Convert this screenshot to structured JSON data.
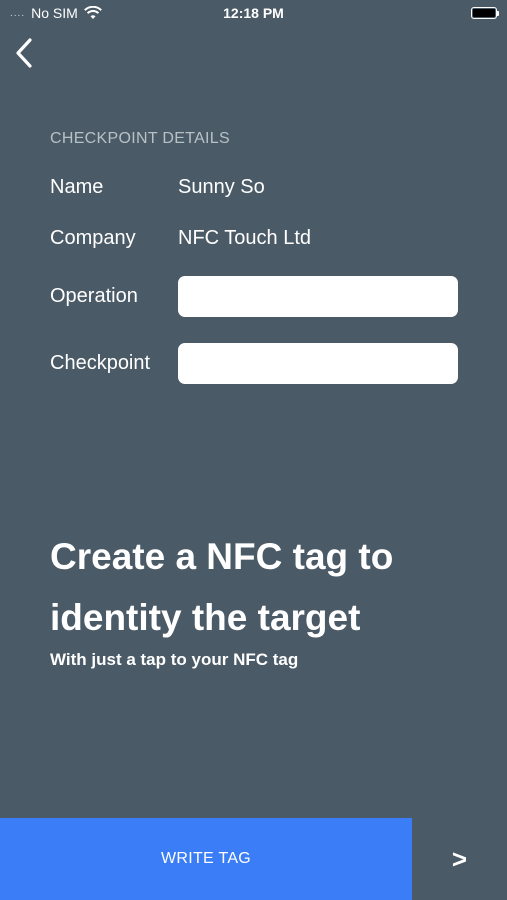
{
  "status_bar": {
    "signal": "....",
    "carrier": "No SIM",
    "time": "12:18 PM",
    "wifi_icon": "wifi-icon",
    "battery_icon": "battery-icon"
  },
  "nav": {
    "back_icon": "chevron-left-icon"
  },
  "details": {
    "section_title": "CHECKPOINT DETAILS",
    "name_label": "Name",
    "name_value": "Sunny So",
    "company_label": "Company",
    "company_value": "NFC Touch Ltd",
    "operation_label": "Operation",
    "operation_value": "",
    "checkpoint_label": "Checkpoint",
    "checkpoint_value": ""
  },
  "promo": {
    "headline": "Create a NFC tag to identity the target",
    "subheadline": "With just a tap to your NFC tag"
  },
  "actions": {
    "write_tag_label": "WRITE TAG",
    "next_label": ">"
  },
  "colors": {
    "background": "#4a5a66",
    "accent": "#3b7df6"
  }
}
